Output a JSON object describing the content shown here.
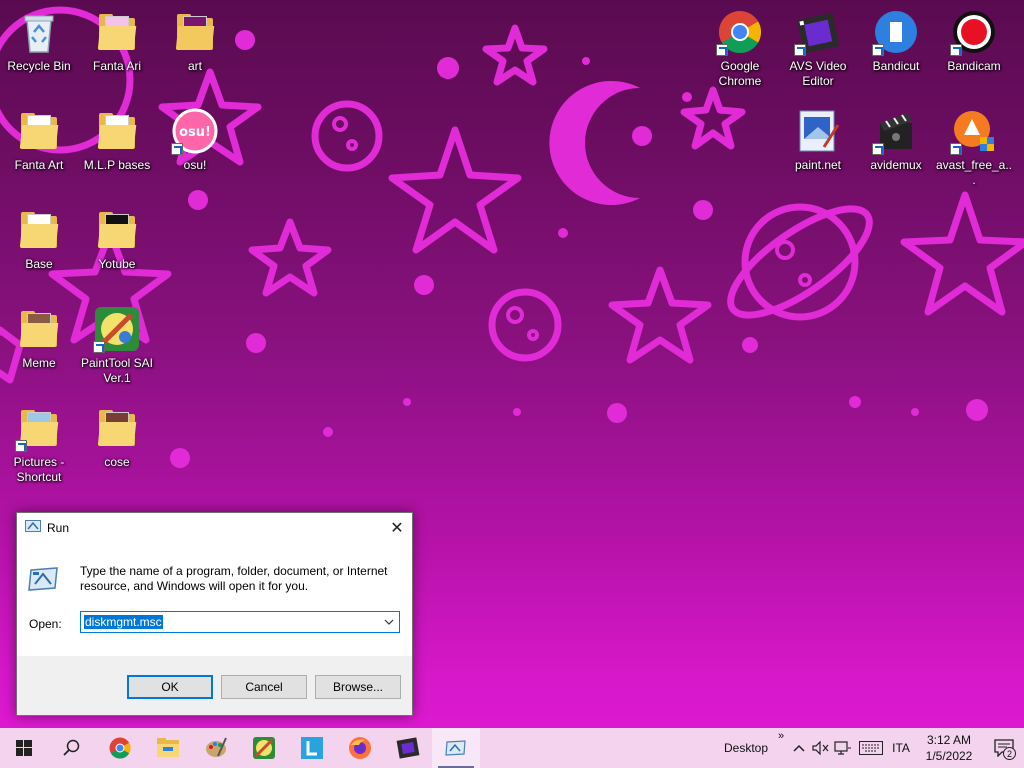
{
  "desktop": {
    "left_icons": [
      {
        "label": "Recycle Bin"
      },
      {
        "label": "Fanta Ari"
      },
      {
        "label": "art"
      },
      {
        "label": "Fanta Art"
      },
      {
        "label": "M.L.P bases"
      },
      {
        "label": "osu!"
      },
      {
        "label": "Base"
      },
      {
        "label": "Yotube"
      },
      {
        "label": "Meme"
      },
      {
        "label": "PaintTool SAI Ver.1"
      },
      {
        "label": "Pictures - Shortcut"
      },
      {
        "label": "cose"
      }
    ],
    "right_icons": [
      {
        "label": "Google Chrome"
      },
      {
        "label": "AVS Video Editor"
      },
      {
        "label": "Bandicut"
      },
      {
        "label": "Bandicam"
      },
      {
        "label": "paint.net"
      },
      {
        "label": "avidemux"
      },
      {
        "label": "avast_free_a..."
      }
    ],
    "osu_badge": "osu!"
  },
  "run_dialog": {
    "title": "Run",
    "close_glyph": "✕",
    "description": "Type the name of a program, folder, document, or Internet resource, and Windows will open it for you.",
    "open_label": "Open:",
    "input_value": "diskmgmt.msc",
    "ok_label": "OK",
    "cancel_label": "Cancel",
    "browse_label": "Browse..."
  },
  "taskbar": {
    "desktop_label": "Desktop",
    "chevron": "»",
    "language": "ITA",
    "time": "3:12 AM",
    "date": "1/5/2022",
    "notification_count": "2",
    "app_icons": [
      "chrome-icon",
      "file-explorer-icon",
      "painttool-icon",
      "paintnet-icon",
      "l-app-icon",
      "firefox-icon",
      "avs-video-icon",
      "run-icon"
    ]
  },
  "colors": {
    "wallpaper_top": "#5a0b50",
    "wallpaper_bottom": "#e11ad6",
    "star_color": "#e02bd6",
    "taskbar": "#f3d3ee",
    "accent": "#0078d7"
  }
}
